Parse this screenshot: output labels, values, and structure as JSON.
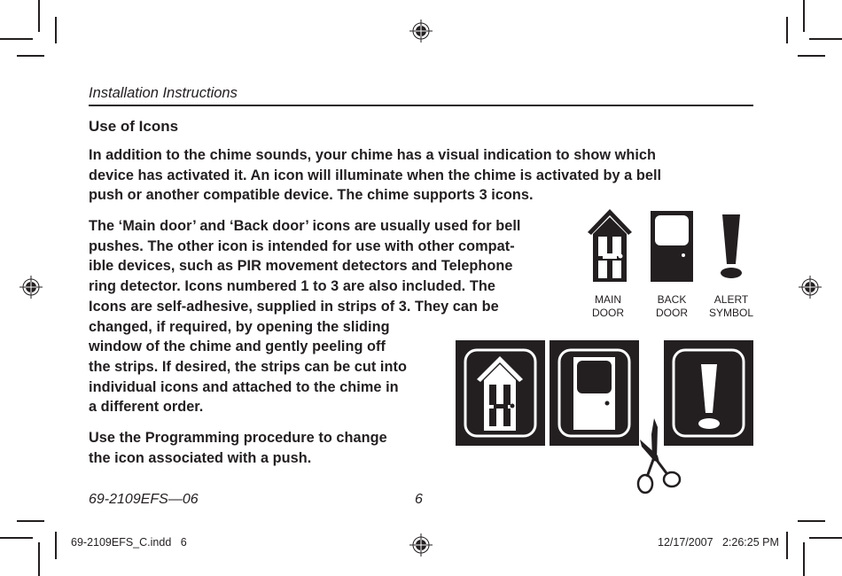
{
  "header": {
    "running_head": "Installation Instructions"
  },
  "section": {
    "title": "Use of Icons",
    "paragraph_1_lines": [
      "In addition to the chime sounds, your chime has a visual indication to show which",
      "device has activated it. An icon will illuminate when the chime is activated by a bell",
      "push or another compatible device. The chime supports 3 icons."
    ],
    "paragraph_2_lines": [
      "The ‘Main door’ and ‘Back door’ icons are usually used for bell",
      "pushes. The other icon is intended for use with other compat-",
      "ible devices, such as PIR movement detectors and Telephone",
      "ring detector. Icons numbered 1 to 3 are also included. The",
      "Icons are self-adhesive, supplied in strips of 3. They can be",
      "changed, if required, by opening the sliding",
      "window of the chime and gently peeling off",
      "the strips. If desired, the strips can be cut into",
      "individual icons and attached to the chime in",
      "a different order."
    ],
    "paragraph_3_lines": [
      "Use the Programming procedure to change",
      "the icon associated with a push."
    ]
  },
  "icon_legend": [
    {
      "icon": "main-door-icon",
      "label_line1": "MAIN",
      "label_line2": "DOOR"
    },
    {
      "icon": "back-door-icon",
      "label_line1": "BACK",
      "label_line2": "DOOR"
    },
    {
      "icon": "alert-symbol-icon",
      "label_line1": "ALERT",
      "label_line2": "SYMBOL"
    }
  ],
  "icon_strip": {
    "items": [
      "main-door-icon",
      "back-door-icon",
      "alert-symbol-icon"
    ],
    "cut_tool": "scissors-icon"
  },
  "footer": {
    "doc_number": "69-2109EFS—06",
    "page_number": "6"
  },
  "slug": {
    "file": "69-2109EFS_C.indd   6",
    "timestamp": "12/17/2007   2:26:25 PM"
  },
  "colors": {
    "ink": "#231f20",
    "paper": "#ffffff"
  }
}
